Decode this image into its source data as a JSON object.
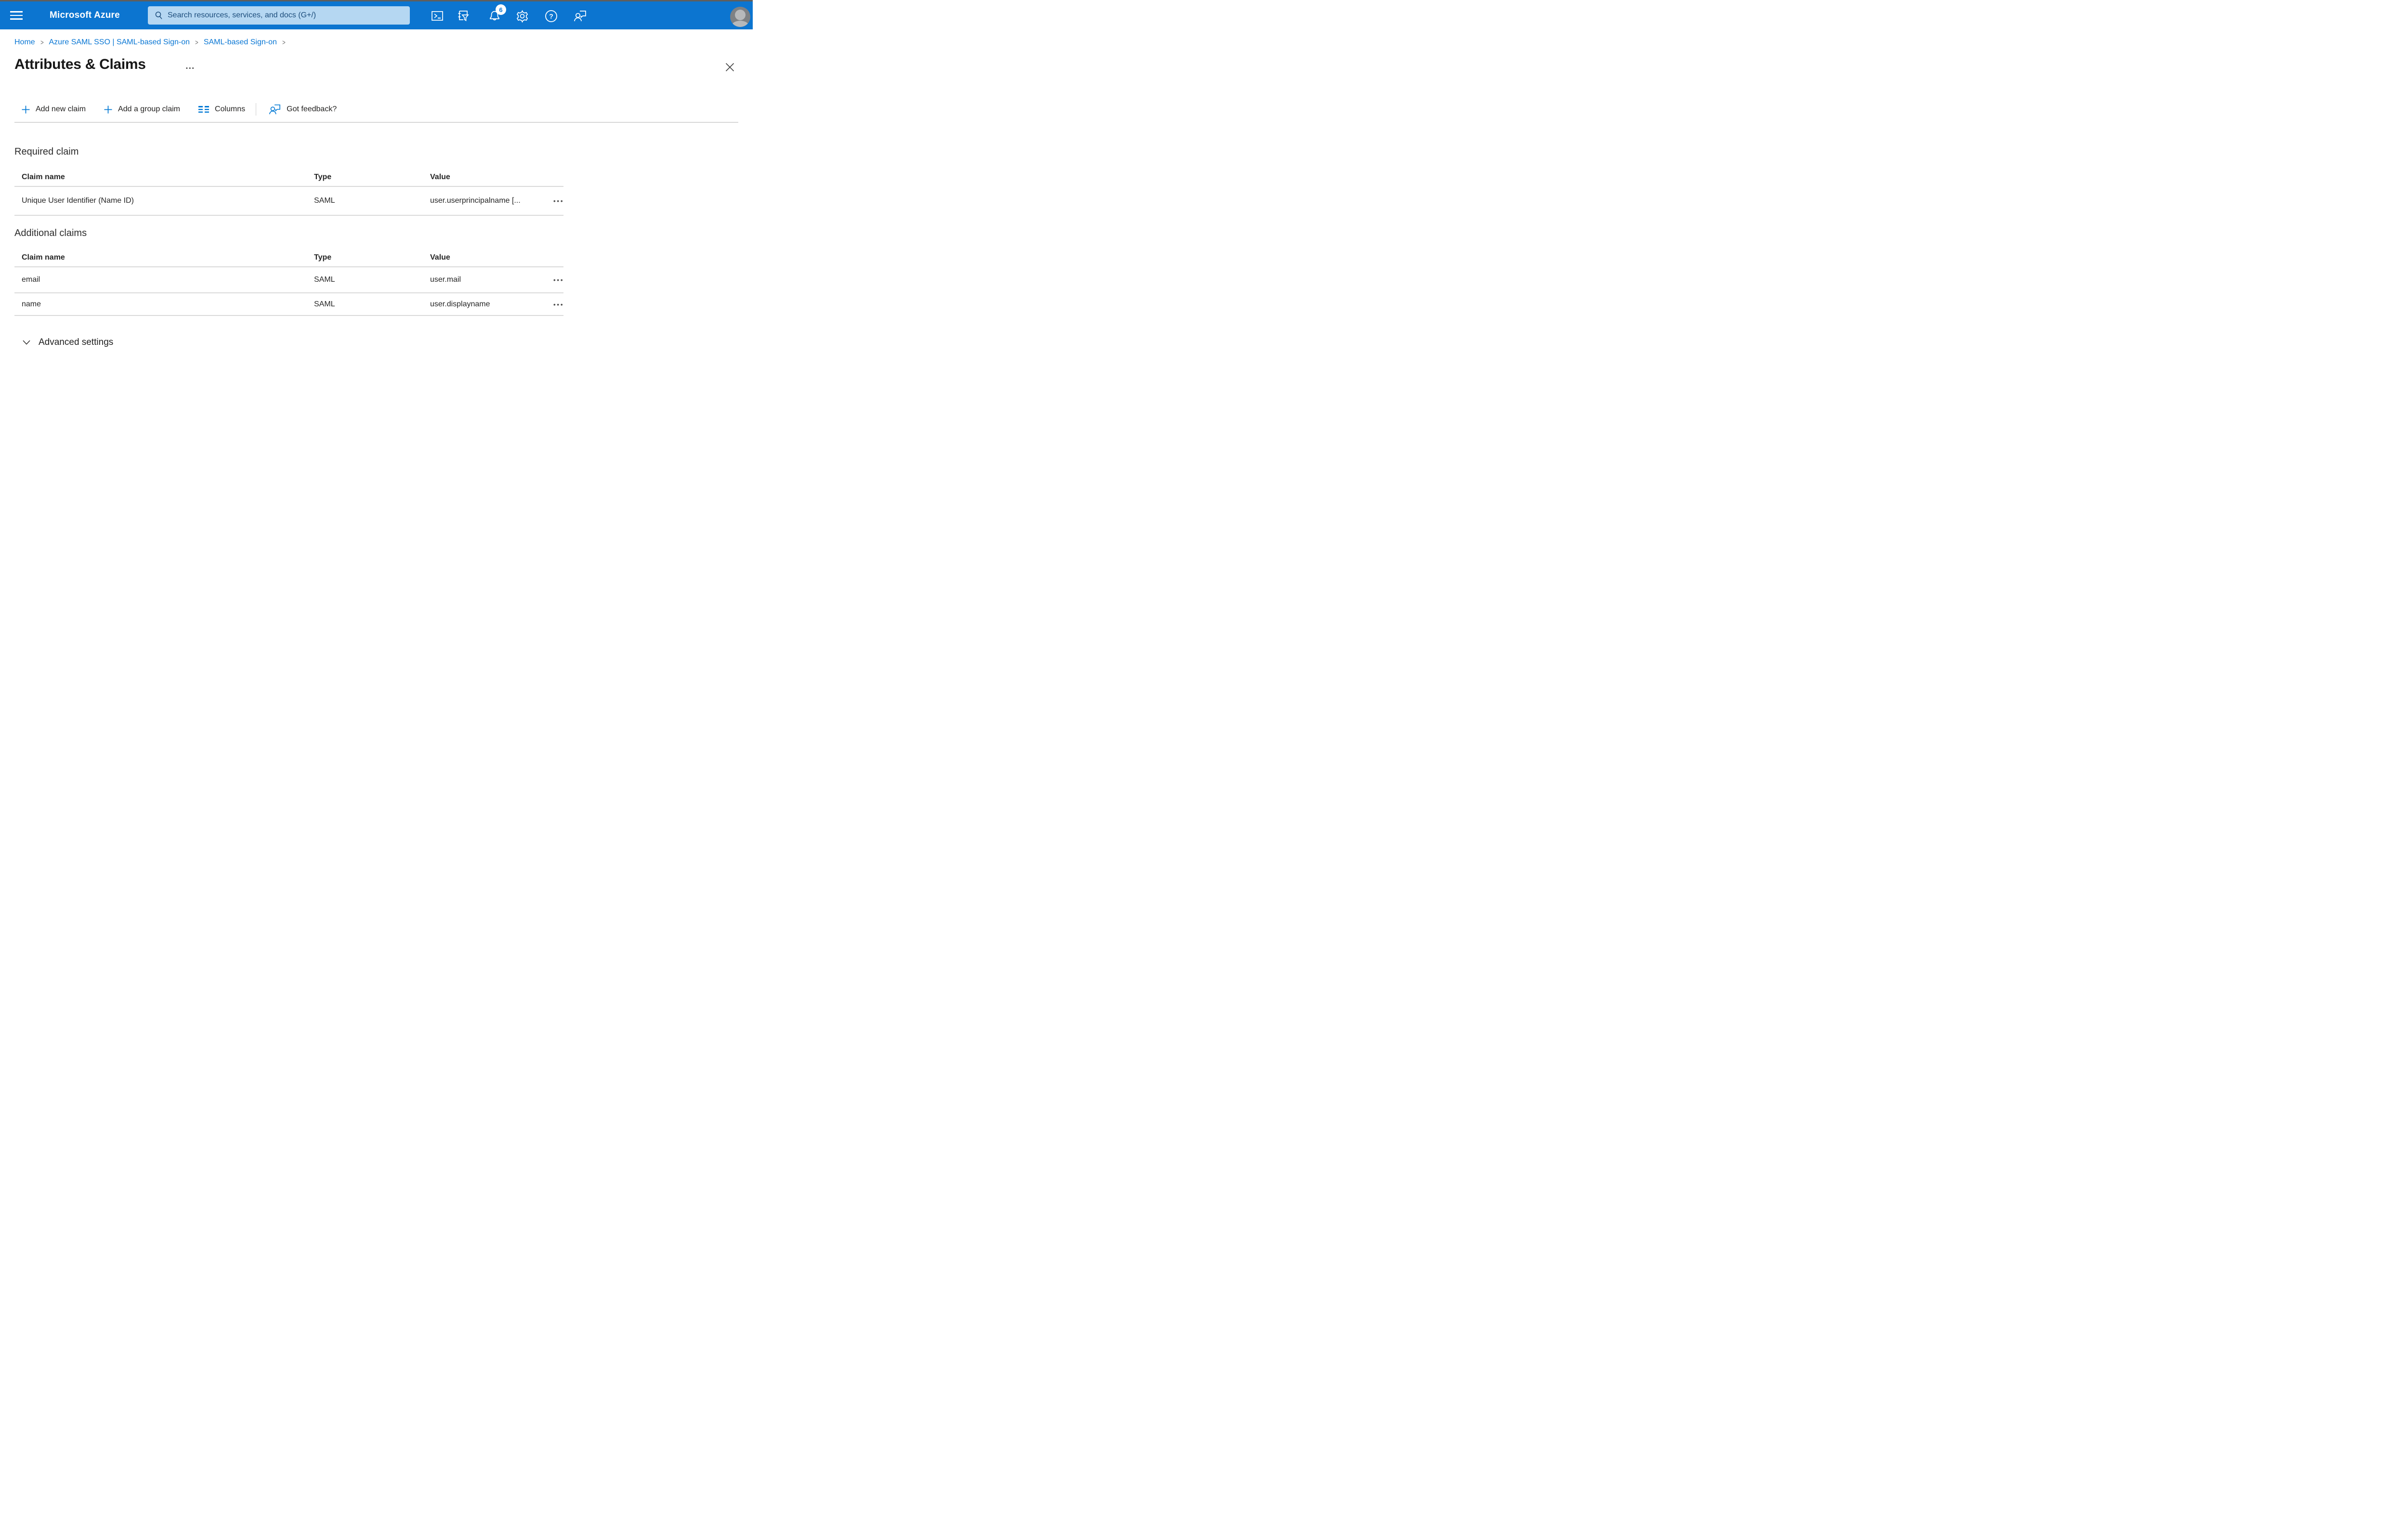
{
  "header": {
    "brand": "Microsoft Azure",
    "search_placeholder": "Search resources, services, and docs (G+/)",
    "notification_count": "6"
  },
  "breadcrumb": {
    "items": [
      "Home",
      "Azure SAML SSO | SAML-based Sign-on",
      "SAML-based Sign-on"
    ],
    "separator": ">"
  },
  "page": {
    "title": "Attributes & Claims",
    "overflow_dots": "•••",
    "close_label": "✕"
  },
  "toolbar": {
    "add_new_claim": "Add new claim",
    "add_group_claim": "Add a group claim",
    "columns": "Columns",
    "got_feedback": "Got feedback?"
  },
  "required_claim": {
    "heading": "Required claim",
    "columns": [
      "Claim name",
      "Type",
      "Value"
    ],
    "rows": [
      {
        "claim_name": "Unique User Identifier (Name ID)",
        "type": "SAML",
        "value": "user.userprincipalname [...",
        "menu": "•••"
      }
    ]
  },
  "additional_claims": {
    "heading": "Additional claims",
    "columns": [
      "Claim name",
      "Type",
      "Value"
    ],
    "rows": [
      {
        "claim_name": "email",
        "type": "SAML",
        "value": "user.mail",
        "menu": "•••"
      },
      {
        "claim_name": "name",
        "type": "SAML",
        "value": "user.displayname",
        "menu": "•••"
      }
    ]
  },
  "advanced_settings": {
    "label": "Advanced settings"
  },
  "colors": {
    "header_bg": "#0c75d0",
    "accent_blue": "#0078d4",
    "search_bg": "#b5d7f2",
    "search_text": "#1c4d7c",
    "divider": "#d8d8d8",
    "text": "#2b2b2b"
  }
}
